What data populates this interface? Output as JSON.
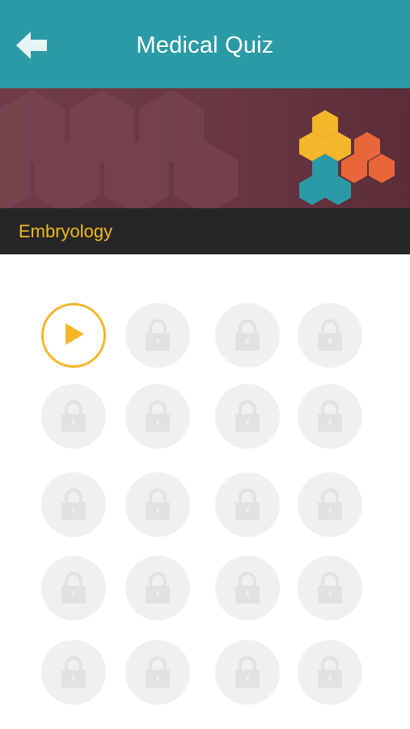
{
  "header": {
    "title": "Medical Quiz",
    "back_icon": "back-arrow-icon",
    "color": "#2a9ba6"
  },
  "category": {
    "label": "Embryology",
    "label_color": "#f3b81f"
  },
  "levels": {
    "total": 20,
    "columns": 4,
    "unlocked": 1,
    "active_icon": "play-icon",
    "locked_icon": "lock-icon",
    "accent_color": "#f5b62a"
  }
}
